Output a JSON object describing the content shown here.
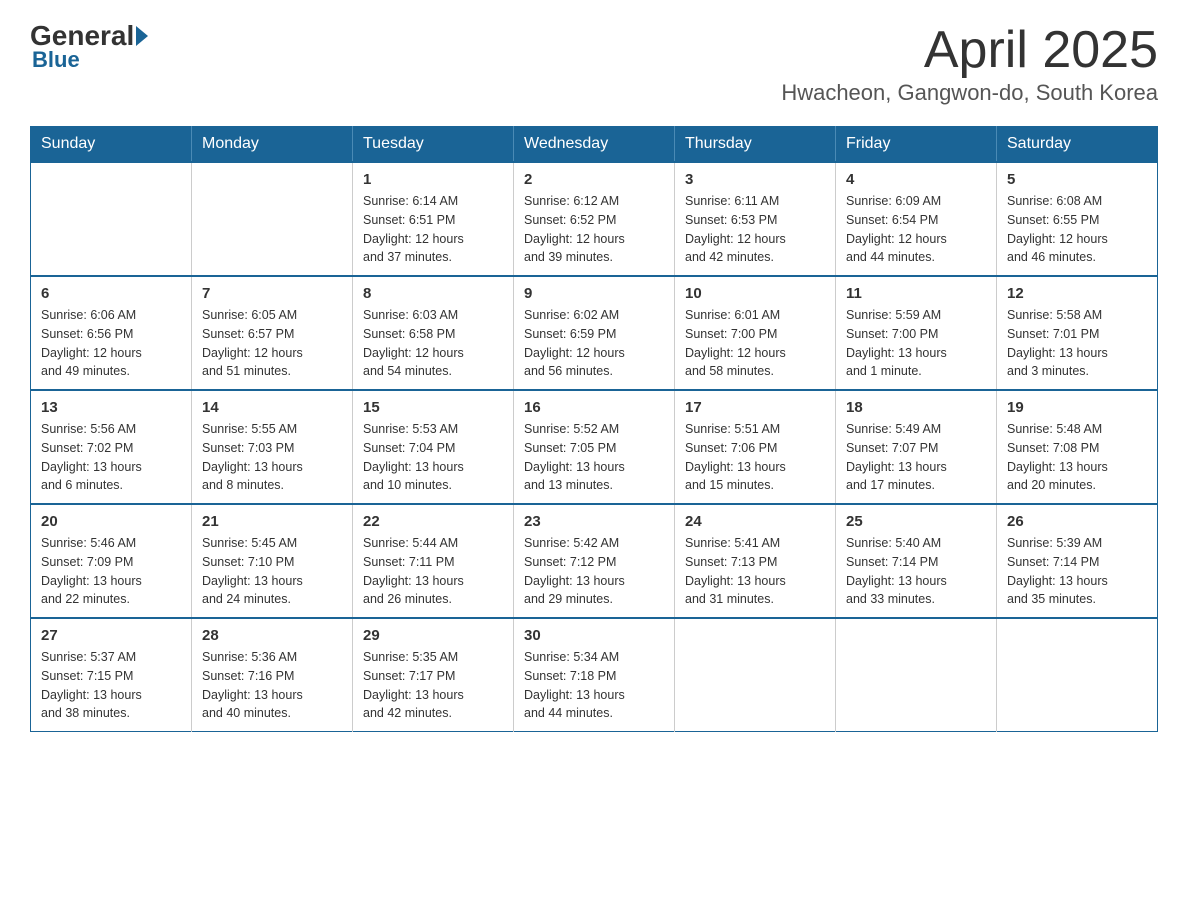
{
  "logo": {
    "general": "General",
    "blue": "Blue"
  },
  "header": {
    "month": "April 2025",
    "location": "Hwacheon, Gangwon-do, South Korea"
  },
  "weekdays": [
    "Sunday",
    "Monday",
    "Tuesday",
    "Wednesday",
    "Thursday",
    "Friday",
    "Saturday"
  ],
  "weeks": [
    [
      {
        "day": "",
        "info": ""
      },
      {
        "day": "",
        "info": ""
      },
      {
        "day": "1",
        "info": "Sunrise: 6:14 AM\nSunset: 6:51 PM\nDaylight: 12 hours\nand 37 minutes."
      },
      {
        "day": "2",
        "info": "Sunrise: 6:12 AM\nSunset: 6:52 PM\nDaylight: 12 hours\nand 39 minutes."
      },
      {
        "day": "3",
        "info": "Sunrise: 6:11 AM\nSunset: 6:53 PM\nDaylight: 12 hours\nand 42 minutes."
      },
      {
        "day": "4",
        "info": "Sunrise: 6:09 AM\nSunset: 6:54 PM\nDaylight: 12 hours\nand 44 minutes."
      },
      {
        "day": "5",
        "info": "Sunrise: 6:08 AM\nSunset: 6:55 PM\nDaylight: 12 hours\nand 46 minutes."
      }
    ],
    [
      {
        "day": "6",
        "info": "Sunrise: 6:06 AM\nSunset: 6:56 PM\nDaylight: 12 hours\nand 49 minutes."
      },
      {
        "day": "7",
        "info": "Sunrise: 6:05 AM\nSunset: 6:57 PM\nDaylight: 12 hours\nand 51 minutes."
      },
      {
        "day": "8",
        "info": "Sunrise: 6:03 AM\nSunset: 6:58 PM\nDaylight: 12 hours\nand 54 minutes."
      },
      {
        "day": "9",
        "info": "Sunrise: 6:02 AM\nSunset: 6:59 PM\nDaylight: 12 hours\nand 56 minutes."
      },
      {
        "day": "10",
        "info": "Sunrise: 6:01 AM\nSunset: 7:00 PM\nDaylight: 12 hours\nand 58 minutes."
      },
      {
        "day": "11",
        "info": "Sunrise: 5:59 AM\nSunset: 7:00 PM\nDaylight: 13 hours\nand 1 minute."
      },
      {
        "day": "12",
        "info": "Sunrise: 5:58 AM\nSunset: 7:01 PM\nDaylight: 13 hours\nand 3 minutes."
      }
    ],
    [
      {
        "day": "13",
        "info": "Sunrise: 5:56 AM\nSunset: 7:02 PM\nDaylight: 13 hours\nand 6 minutes."
      },
      {
        "day": "14",
        "info": "Sunrise: 5:55 AM\nSunset: 7:03 PM\nDaylight: 13 hours\nand 8 minutes."
      },
      {
        "day": "15",
        "info": "Sunrise: 5:53 AM\nSunset: 7:04 PM\nDaylight: 13 hours\nand 10 minutes."
      },
      {
        "day": "16",
        "info": "Sunrise: 5:52 AM\nSunset: 7:05 PM\nDaylight: 13 hours\nand 13 minutes."
      },
      {
        "day": "17",
        "info": "Sunrise: 5:51 AM\nSunset: 7:06 PM\nDaylight: 13 hours\nand 15 minutes."
      },
      {
        "day": "18",
        "info": "Sunrise: 5:49 AM\nSunset: 7:07 PM\nDaylight: 13 hours\nand 17 minutes."
      },
      {
        "day": "19",
        "info": "Sunrise: 5:48 AM\nSunset: 7:08 PM\nDaylight: 13 hours\nand 20 minutes."
      }
    ],
    [
      {
        "day": "20",
        "info": "Sunrise: 5:46 AM\nSunset: 7:09 PM\nDaylight: 13 hours\nand 22 minutes."
      },
      {
        "day": "21",
        "info": "Sunrise: 5:45 AM\nSunset: 7:10 PM\nDaylight: 13 hours\nand 24 minutes."
      },
      {
        "day": "22",
        "info": "Sunrise: 5:44 AM\nSunset: 7:11 PM\nDaylight: 13 hours\nand 26 minutes."
      },
      {
        "day": "23",
        "info": "Sunrise: 5:42 AM\nSunset: 7:12 PM\nDaylight: 13 hours\nand 29 minutes."
      },
      {
        "day": "24",
        "info": "Sunrise: 5:41 AM\nSunset: 7:13 PM\nDaylight: 13 hours\nand 31 minutes."
      },
      {
        "day": "25",
        "info": "Sunrise: 5:40 AM\nSunset: 7:14 PM\nDaylight: 13 hours\nand 33 minutes."
      },
      {
        "day": "26",
        "info": "Sunrise: 5:39 AM\nSunset: 7:14 PM\nDaylight: 13 hours\nand 35 minutes."
      }
    ],
    [
      {
        "day": "27",
        "info": "Sunrise: 5:37 AM\nSunset: 7:15 PM\nDaylight: 13 hours\nand 38 minutes."
      },
      {
        "day": "28",
        "info": "Sunrise: 5:36 AM\nSunset: 7:16 PM\nDaylight: 13 hours\nand 40 minutes."
      },
      {
        "day": "29",
        "info": "Sunrise: 5:35 AM\nSunset: 7:17 PM\nDaylight: 13 hours\nand 42 minutes."
      },
      {
        "day": "30",
        "info": "Sunrise: 5:34 AM\nSunset: 7:18 PM\nDaylight: 13 hours\nand 44 minutes."
      },
      {
        "day": "",
        "info": ""
      },
      {
        "day": "",
        "info": ""
      },
      {
        "day": "",
        "info": ""
      }
    ]
  ]
}
